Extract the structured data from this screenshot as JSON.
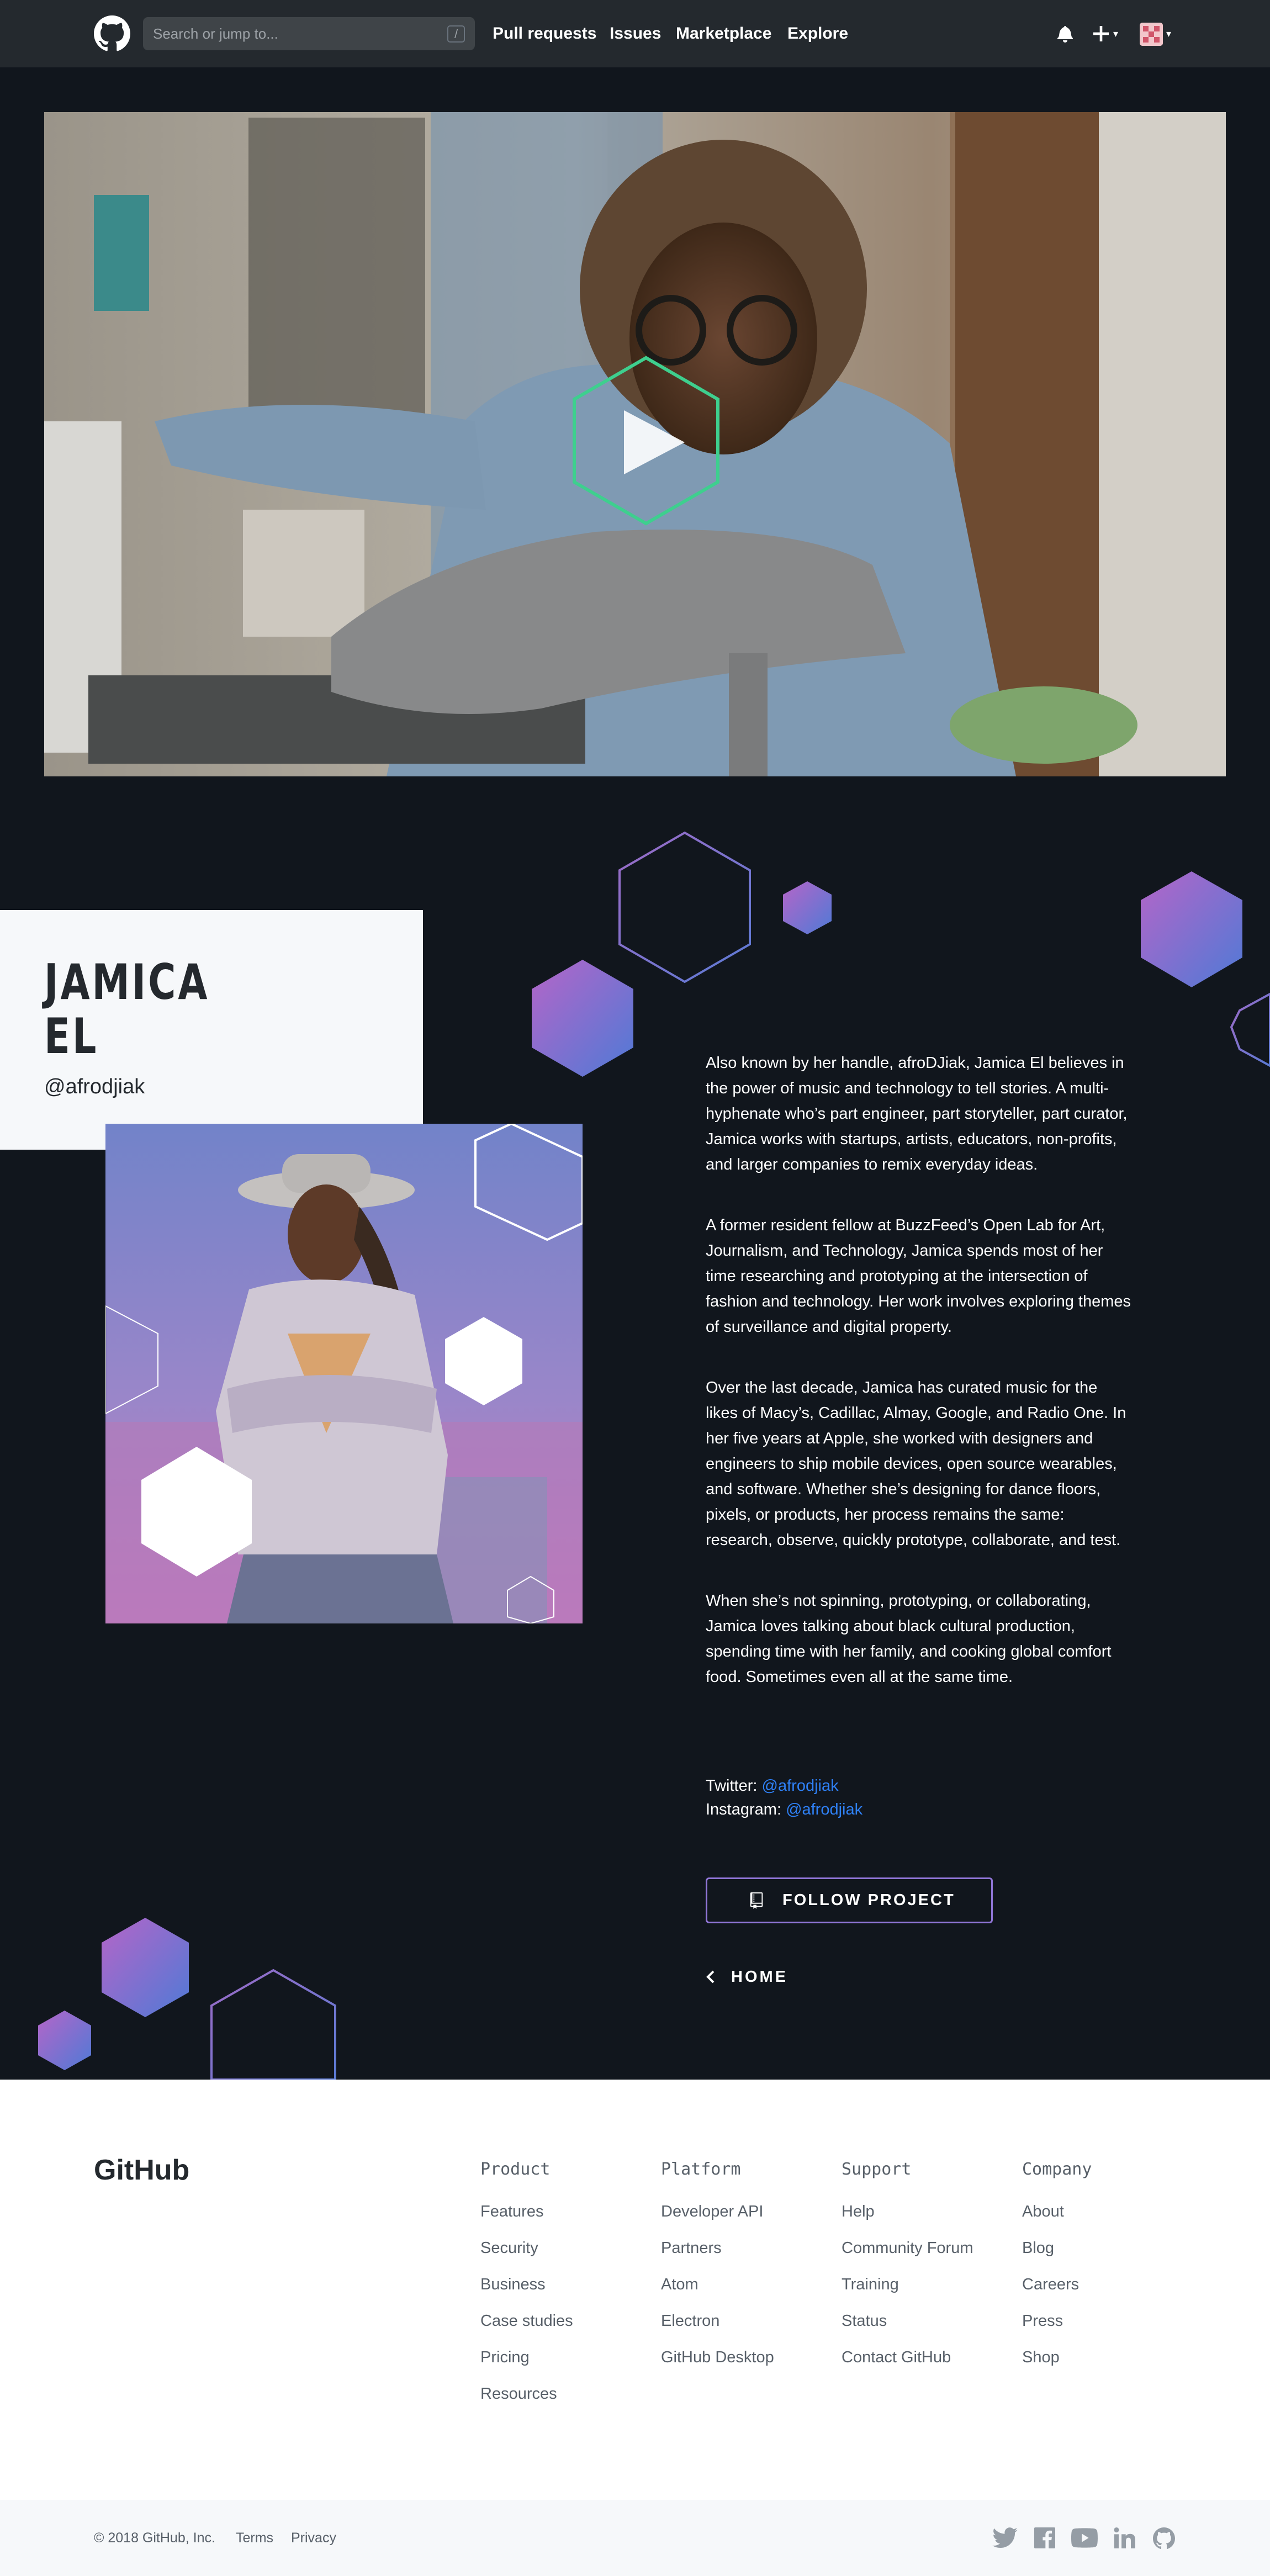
{
  "header": {
    "search_placeholder": "Search or jump to...",
    "search_shortcut": "/",
    "nav": [
      "Pull requests",
      "Issues",
      "Marketplace",
      "Explore"
    ],
    "plus_symbol": "+"
  },
  "profile": {
    "first_name": "JAMICA",
    "last_name": "EL",
    "handle": "@afrodjiak",
    "bio": [
      "Also known by her handle, afroDJiak, Jamica El believes in the power of music and technology to tell stories. A multi-hyphenate who’s part engineer, part storyteller, part curator, Jamica works with startups, artists, educators, non-profits, and larger companies to remix everyday ideas.",
      "A former resident fellow at BuzzFeed’s Open Lab for Art, Journalism, and Technology, Jamica spends most of her time researching and prototyping at the intersection of fashion and technology. Her work involves exploring themes of surveillance and digital property.",
      "Over the last decade, Jamica has curated music for the likes of Macy’s, Cadillac, Almay, Google, and Radio One. In her five years at Apple, she worked with designers and engineers to ship mobile devices, open source wearables, and software. Whether she’s designing for dance floors, pixels, or products, her process remains the same: research, observe, quickly prototype, collaborate, and test.",
      "When she’s not spinning, prototyping, or collaborating, Jamica loves talking about black cultural production, spending time with her family, and cooking global comfort food. Sometimes even all at the same time."
    ],
    "twitter_label": "Twitter:",
    "twitter_handle": "@afrodjiak",
    "instagram_label": "Instagram:",
    "instagram_handle": "@afrodjiak",
    "follow_label": "FOLLOW PROJECT",
    "home_label": "HOME"
  },
  "footer": {
    "brand": "GitHub",
    "columns": [
      {
        "title": "Product",
        "links": [
          "Features",
          "Security",
          "Business",
          "Case studies",
          "Pricing",
          "Resources"
        ]
      },
      {
        "title": "Platform",
        "links": [
          "Developer API",
          "Partners",
          "Atom",
          "Electron",
          "GitHub Desktop"
        ]
      },
      {
        "title": "Support",
        "links": [
          "Help",
          "Community Forum",
          "Training",
          "Status",
          "Contact GitHub"
        ]
      },
      {
        "title": "Company",
        "links": [
          "About",
          "Blog",
          "Careers",
          "Press",
          "Shop"
        ]
      }
    ],
    "copyright": "© 2018 GitHub, Inc.",
    "terms": "Terms",
    "privacy": "Privacy",
    "social_icons": [
      "twitter-icon",
      "facebook-icon",
      "youtube-icon",
      "linkedin-icon",
      "github-icon"
    ]
  },
  "colors": {
    "page_bg": "#11161d",
    "header_bg": "#24292e",
    "accent_purple": "#9d6bc6",
    "accent_blue": "#5b7bd5",
    "link_blue": "#2f81f7",
    "play_hexagon": "#3ecf8e"
  }
}
